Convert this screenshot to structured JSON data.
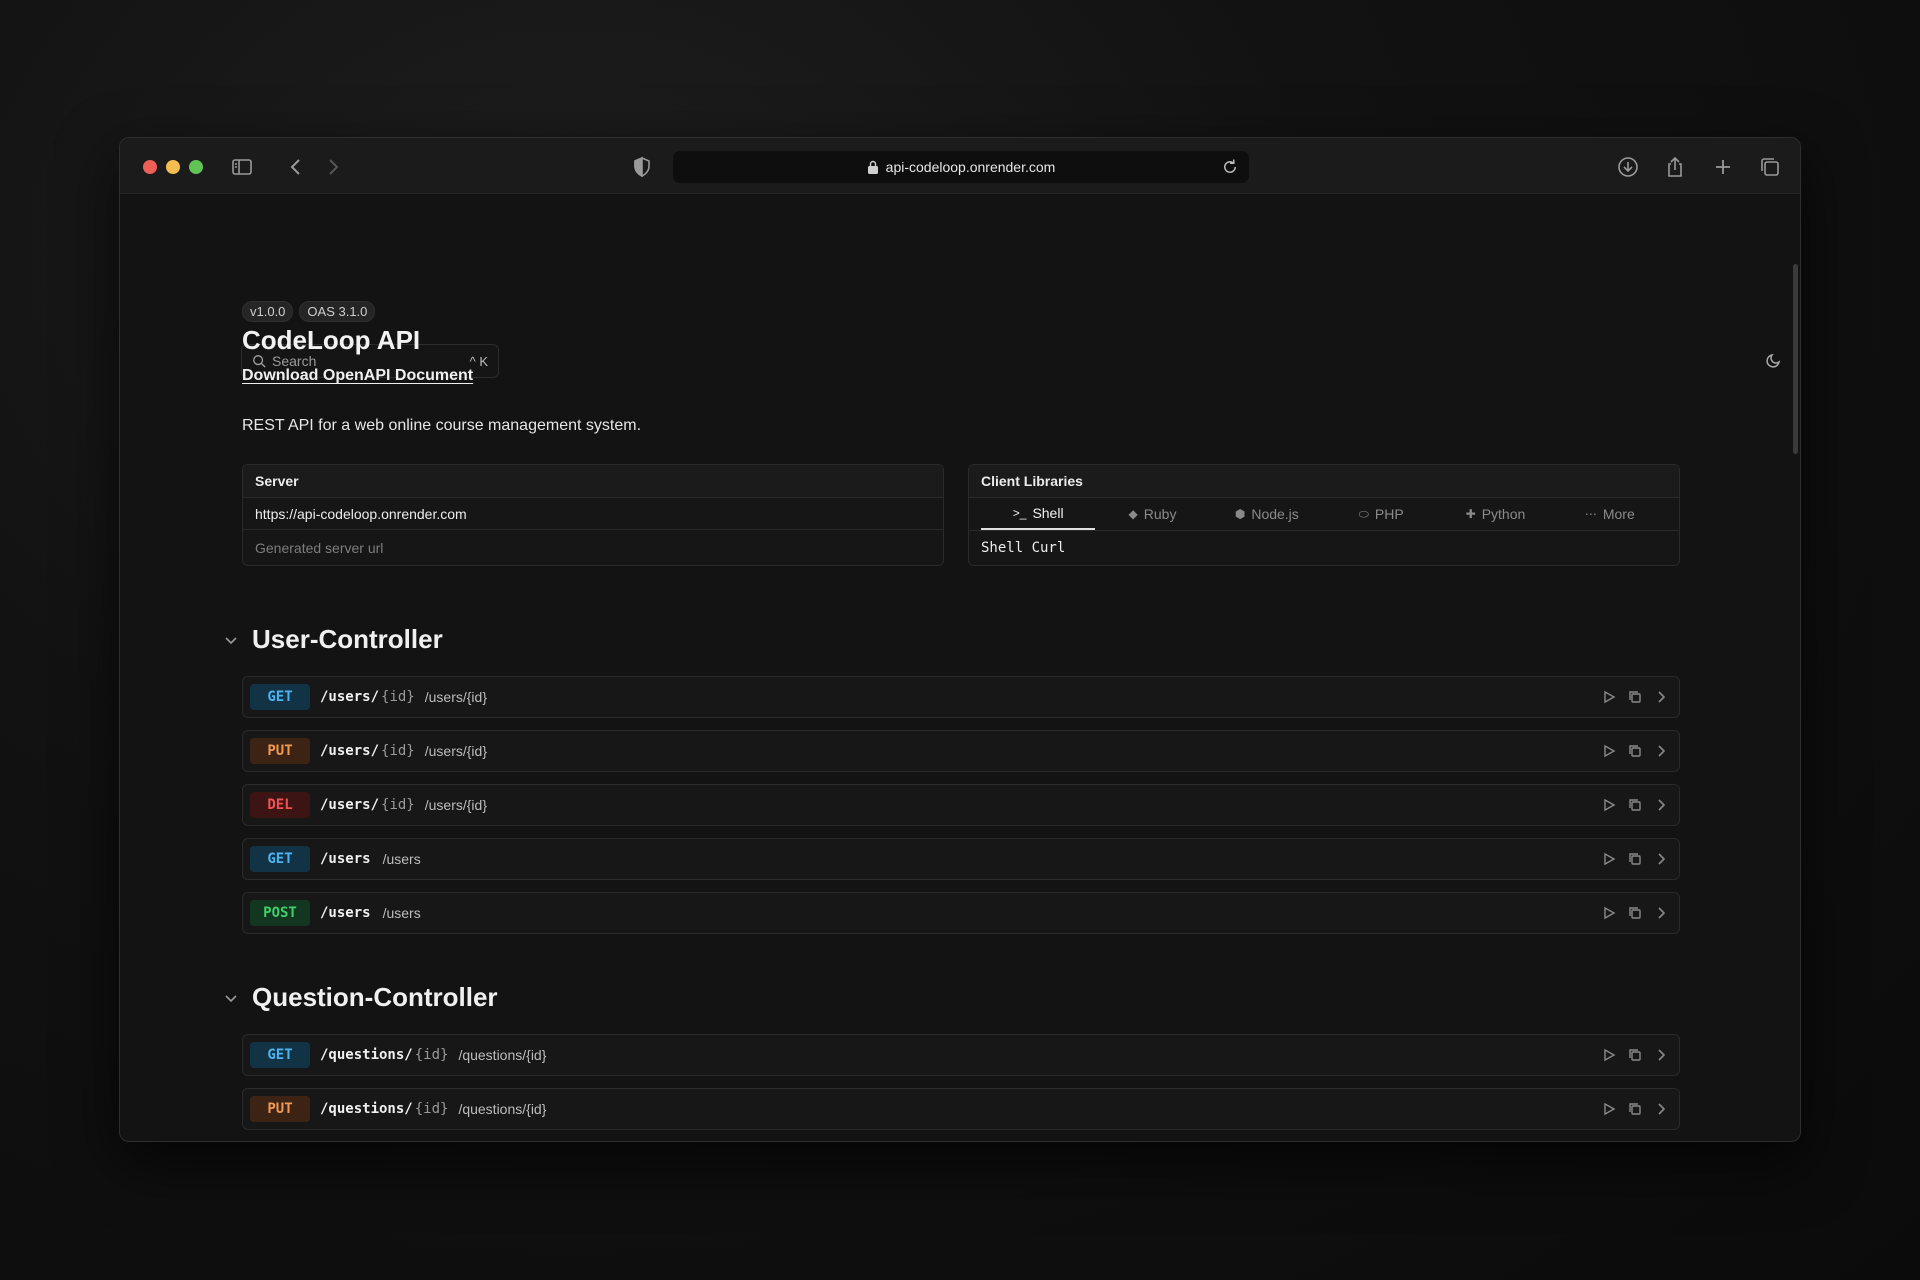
{
  "browser": {
    "url": "api-codeloop.onrender.com"
  },
  "search": {
    "placeholder": "Search",
    "shortcut": "^ K"
  },
  "info": {
    "version": "v1.0.0",
    "oas": "OAS 3.1.0",
    "title": "CodeLoop API",
    "download_label": "Download OpenAPI Document",
    "description": "REST API for a web online course management system."
  },
  "server": {
    "heading": "Server",
    "url": "https://api-codeloop.onrender.com",
    "description": "Generated server url"
  },
  "clients": {
    "heading": "Client Libraries",
    "tabs": [
      {
        "label": "Shell",
        "icon": "terminal-icon",
        "glyph": ">_"
      },
      {
        "label": "Ruby",
        "icon": "ruby-icon",
        "glyph": "◆"
      },
      {
        "label": "Node.js",
        "icon": "nodejs-icon",
        "glyph": "⬢"
      },
      {
        "label": "PHP",
        "icon": "php-icon",
        "glyph": "⬭"
      },
      {
        "label": "Python",
        "icon": "python-icon",
        "glyph": "✚"
      },
      {
        "label": "More",
        "icon": "more-icon",
        "glyph": "⋯"
      }
    ],
    "active_tab": "Shell",
    "selected_client": "Shell Curl"
  },
  "sections": [
    {
      "title": "User-Controller",
      "endpoints": [
        {
          "method": "GET",
          "path": "/users/",
          "param": "{id}",
          "summary": "/users/{id}"
        },
        {
          "method": "PUT",
          "path": "/users/",
          "param": "{id}",
          "summary": "/users/{id}"
        },
        {
          "method": "DEL",
          "path": "/users/",
          "param": "{id}",
          "summary": "/users/{id}"
        },
        {
          "method": "GET",
          "path": "/users",
          "param": "",
          "summary": "/users"
        },
        {
          "method": "POST",
          "path": "/users",
          "param": "",
          "summary": "/users"
        }
      ]
    },
    {
      "title": "Question-Controller",
      "endpoints": [
        {
          "method": "GET",
          "path": "/questions/",
          "param": "{id}",
          "summary": "/questions/{id}"
        },
        {
          "method": "PUT",
          "path": "/questions/",
          "param": "{id}",
          "summary": "/questions/{id}"
        }
      ]
    }
  ],
  "colors": {
    "get": "#4db4f0",
    "put": "#f19a54",
    "delete": "#f05252",
    "post": "#41cf6b"
  }
}
